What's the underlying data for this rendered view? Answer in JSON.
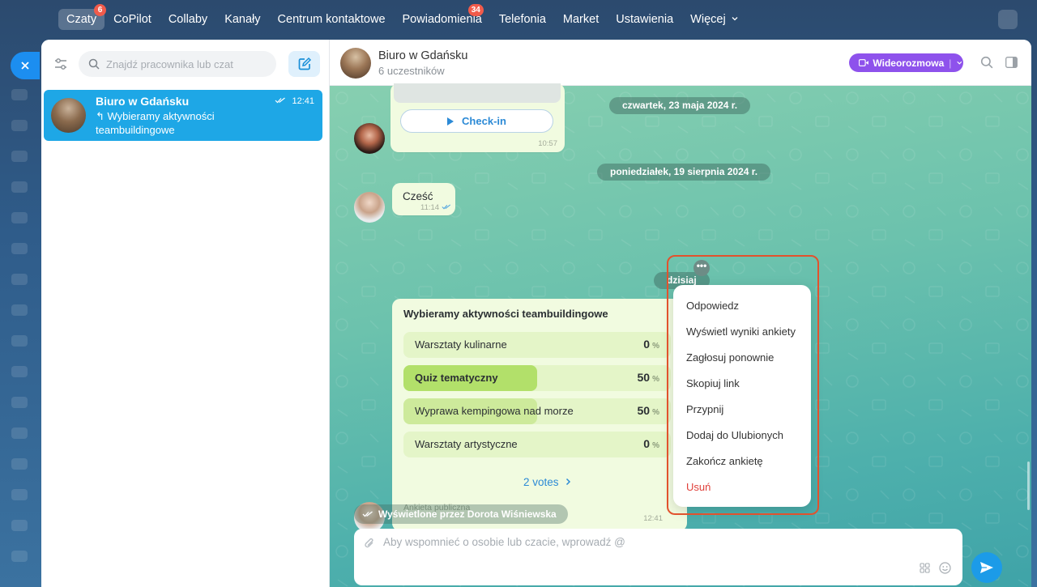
{
  "topnav": {
    "items": [
      {
        "label": "Czaty",
        "badge": "6"
      },
      {
        "label": "CoPilot",
        "badge": ""
      },
      {
        "label": "Collaby",
        "badge": ""
      },
      {
        "label": "Kanały",
        "badge": ""
      },
      {
        "label": "Centrum kontaktowe",
        "badge": ""
      },
      {
        "label": "Powiadomienia",
        "badge": "34"
      },
      {
        "label": "Telefonia",
        "badge": ""
      },
      {
        "label": "Market",
        "badge": ""
      },
      {
        "label": "Ustawienia",
        "badge": ""
      },
      {
        "label": "Więcej",
        "badge": ""
      }
    ],
    "active_index": 0
  },
  "sidebar": {
    "search_placeholder": "Znajdź pracownika lub czat",
    "chats": [
      {
        "title": "Biuro w Gdańsku",
        "time": "12:41",
        "preview": "Wybieramy aktywności teambuildingowe"
      }
    ]
  },
  "chat": {
    "title": "Biuro w Gdańsku",
    "subtitle": "6 uczestników",
    "video_label": "Wideorozmowa",
    "dates": {
      "d1": "czwartek, 23 maja 2024 r.",
      "d2": "poniedziałek, 19 sierpnia 2024 r.",
      "d3": "dzisiaj"
    },
    "checkin": {
      "label": "Check-in",
      "time": "10:57"
    },
    "greeting": {
      "text": "Cześć",
      "time": "11:14"
    },
    "poll": {
      "title": "Wybieramy aktywności teambuildingowe",
      "options": [
        {
          "label": "Warsztaty kulinarne",
          "pct": "0",
          "fraction": 0.0
        },
        {
          "label": "Quiz tematyczny",
          "pct": "50",
          "fraction": 0.5
        },
        {
          "label": "Wyprawa kempingowa nad morze",
          "pct": "50",
          "fraction": 0.5
        },
        {
          "label": "Warsztaty artystyczne",
          "pct": "0",
          "fraction": 0.0
        }
      ],
      "unit": "%",
      "votes": "2 votes",
      "visibility": "Ankieta publiczna",
      "time": "12:41"
    },
    "seen_by": "Wyświetlone przez Dorota Wiśniewska",
    "input_placeholder": "Aby wspomnieć o osobie lub czacie, wprowadź @"
  },
  "context_menu": {
    "more_label": "•••",
    "items": [
      {
        "label": "Odpowiedz",
        "danger": false
      },
      {
        "label": "Wyświetl wyniki ankiety",
        "danger": false
      },
      {
        "label": "Zagłosuj ponownie",
        "danger": false
      },
      {
        "label": "Skopiuj link",
        "danger": false
      },
      {
        "label": "Przypnij",
        "danger": false
      },
      {
        "label": "Dodaj do Ulubionych",
        "danger": false
      },
      {
        "label": "Zakończ ankietę",
        "danger": false
      },
      {
        "label": "Usuń",
        "danger": true
      }
    ]
  },
  "colors": {
    "accent": "#1ea7e6",
    "video": "#8e52ec",
    "poll_fill": "#b2e06a",
    "danger": "#e0403a",
    "highlight": "#e2522d"
  }
}
